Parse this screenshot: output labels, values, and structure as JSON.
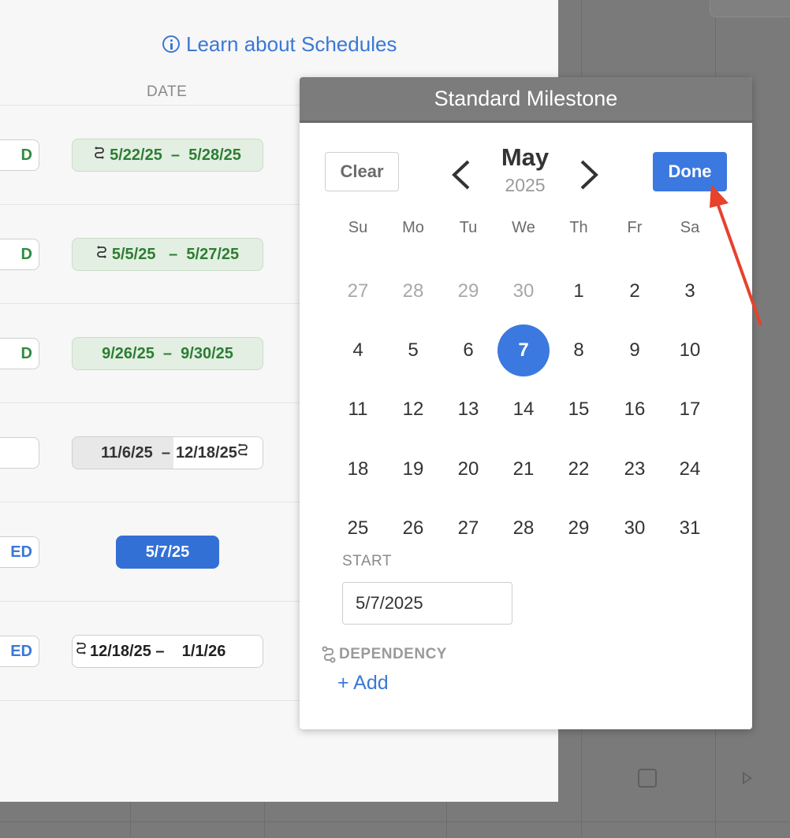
{
  "learn_link": "Learn about Schedules",
  "table": {
    "date_header": "DATE",
    "rows": [
      {
        "status": "D",
        "status_color": "#2e8b3e",
        "date": "5/22/25  –  5/28/25",
        "style": "green",
        "dep": true
      },
      {
        "status": "D",
        "status_color": "#2e8b3e",
        "date": "5/5/25   –  5/27/25",
        "style": "green",
        "dep": true
      },
      {
        "status": "D",
        "status_color": "#2e8b3e",
        "date": "9/26/25  –  9/30/25",
        "style": "green",
        "dep": false
      },
      {
        "status": "",
        "status_color": "#2e8b3e",
        "date_left": "11/6/25",
        "date_right": "12/18/25",
        "style": "split",
        "dep": true
      },
      {
        "status": "ED",
        "status_color": "#3a78d6",
        "date": "5/7/25",
        "style": "blue",
        "dep": false
      },
      {
        "status": "ED",
        "status_color": "#3a78d6",
        "date": "12/18/25 –    1/1/26",
        "style": "white",
        "dep": true
      }
    ]
  },
  "popover": {
    "title": "Standard Milestone",
    "clear_label": "Clear",
    "done_label": "Done",
    "month": "May",
    "year": "2025",
    "weekdays": [
      "Su",
      "Mo",
      "Tu",
      "We",
      "Th",
      "Fr",
      "Sa"
    ],
    "weeks": [
      [
        "27",
        "28",
        "29",
        "30",
        "1",
        "2",
        "3"
      ],
      [
        "4",
        "5",
        "6",
        "7",
        "8",
        "9",
        "10"
      ],
      [
        "11",
        "12",
        "13",
        "14",
        "15",
        "16",
        "17"
      ],
      [
        "18",
        "19",
        "20",
        "21",
        "22",
        "23",
        "24"
      ],
      [
        "25",
        "26",
        "27",
        "28",
        "29",
        "30",
        "31"
      ]
    ],
    "muted_first_row_count": 4,
    "selected_day": "7",
    "start_label": "START",
    "start_value": "5/7/2025",
    "dependency_label": "DEPENDENCY",
    "add_label": "+ Add"
  },
  "colors": {
    "accent": "#3b78e0",
    "link": "#3a78d6",
    "annotation_arrow": "#e8412c"
  }
}
